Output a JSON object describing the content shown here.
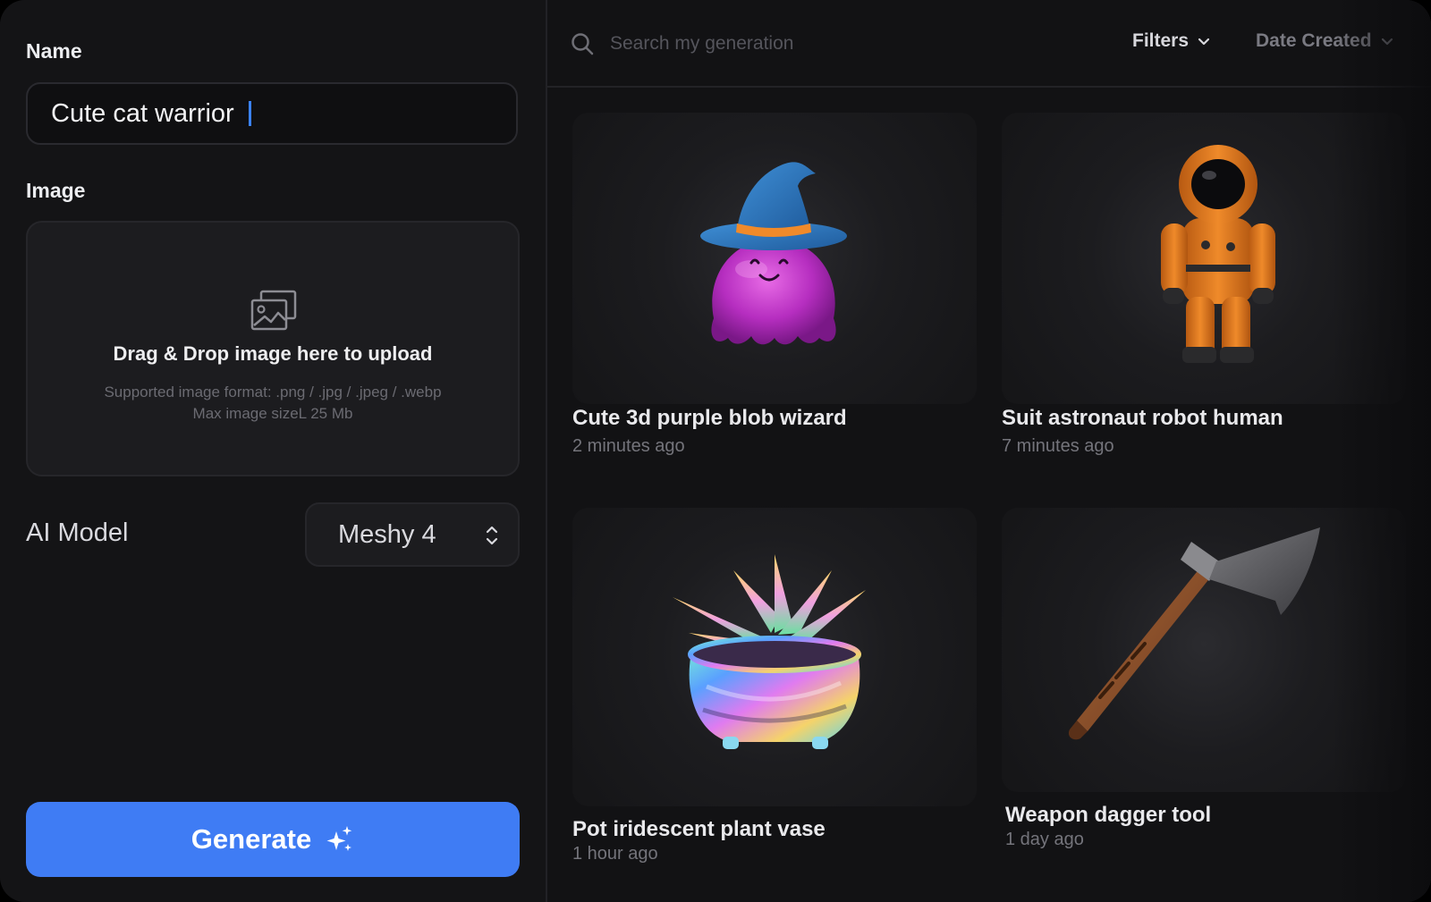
{
  "form": {
    "name_label": "Name",
    "name_value": "Cute cat warrior",
    "image_label": "Image",
    "dropzone": {
      "title": "Drag & Drop image here to upload",
      "formats": "Supported image format: .png / .jpg / .jpeg / .webp",
      "max_size": "Max image sizeL 25 Mb"
    },
    "model_label": "AI Model",
    "model_value": "Meshy 4",
    "generate_label": "Generate"
  },
  "toolbar": {
    "search_placeholder": "Search my generation",
    "filters_label": "Filters",
    "sort_label": "Date Created"
  },
  "generations": [
    {
      "title": "Cute 3d purple blob wizard",
      "time": "2 minutes ago"
    },
    {
      "title": "Suit astronaut robot human",
      "time": "7 minutes ago"
    },
    {
      "title": "Pot iridescent plant vase",
      "time": "1 hour ago"
    },
    {
      "title": "Weapon dagger tool",
      "time": "1 day ago"
    }
  ],
  "colors": {
    "accent": "#3f7cf4",
    "panel": "#141416",
    "background": "#121214"
  }
}
